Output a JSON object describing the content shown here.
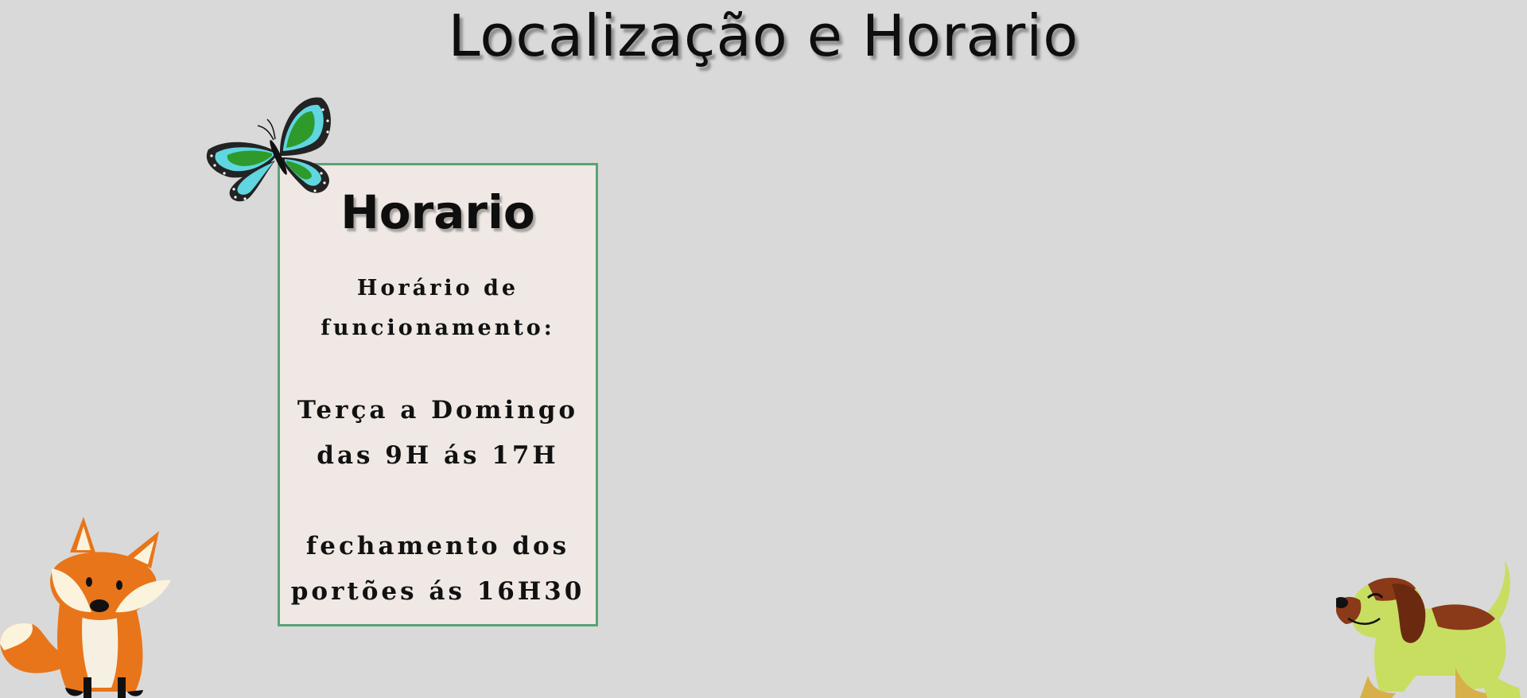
{
  "page": {
    "title": "Localização e Horario"
  },
  "hours_card": {
    "title": "Horario",
    "label_line1": "Horário de",
    "label_line2": "funcionamento:",
    "days_line": "Terça a Domingo",
    "time_line": "das 9H ás 17H",
    "closing_line1": "fechamento dos",
    "closing_line2": "portões ás 16H30"
  },
  "decorations": {
    "butterfly": "butterfly-illustration",
    "fox": "fox-illustration",
    "dog": "dog-illustration"
  },
  "colors": {
    "background": "#d9d9d9",
    "card_background": "#efe8e4",
    "card_border": "#5aa377"
  }
}
